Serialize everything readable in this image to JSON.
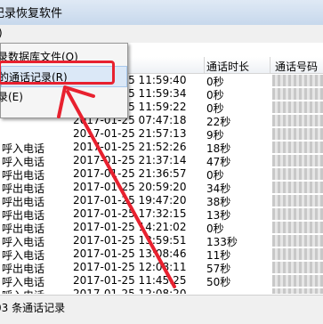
{
  "window": {
    "title": "记录恢复软件"
  },
  "menubar": {
    "first_menu": ")"
  },
  "dropdown": {
    "items": [
      {
        "label": "录数据库文件(O)"
      },
      {
        "label": "的通话记录(R)"
      },
      {
        "label": "录(E)"
      }
    ]
  },
  "table": {
    "headers": [
      "通话时长",
      "通话号码"
    ],
    "rows": [
      {
        "type": "",
        "time": "2017-01-25 11:59:40",
        "duration": "0秒"
      },
      {
        "type": "",
        "time": "2017-01-25 11:59:34",
        "duration": "0秒"
      },
      {
        "type": "",
        "time": "2017-01-25 11:59:22",
        "duration": "0秒"
      },
      {
        "type": "",
        "time": "2017-01-25 07:47:18",
        "duration": "22秒"
      },
      {
        "type": "",
        "time": "2017-01-25 21:57:13",
        "duration": "9秒"
      },
      {
        "type": "呼入电话",
        "time": "2017-01-25 21:52:26",
        "duration": "18秒"
      },
      {
        "type": "呼入电话",
        "time": "2017-01-25 21:37:14",
        "duration": "47秒"
      },
      {
        "type": "呼出电话",
        "time": "2017-01-25 21:36:57",
        "duration": "0秒"
      },
      {
        "type": "呼出电话",
        "time": "2017-01-25 20:59:20",
        "duration": "34秒"
      },
      {
        "type": "呼出电话",
        "time": "2017-01-25 19:47:20",
        "duration": "38秒"
      },
      {
        "type": "呼出电话",
        "time": "2017-01-25 17:32:15",
        "duration": "13秒"
      },
      {
        "type": "呼出电话",
        "time": "2017-01-25 14:21:02",
        "duration": "0秒"
      },
      {
        "type": "呼入电话",
        "time": "2017-01-25 13:59:51",
        "duration": "133秒"
      },
      {
        "type": "呼入电话",
        "time": "2017-01-25 13:08:46",
        "duration": "11秒"
      },
      {
        "type": "呼出电话",
        "time": "2017-01-25 12:08:11",
        "duration": "57秒"
      },
      {
        "type": "呼入电话",
        "time": "2017-01-25 11:45:25",
        "duration": "50秒"
      },
      {
        "type": "呼入电话",
        "time": "2017-01-25 12:08:20",
        "duration": ""
      }
    ]
  },
  "status": {
    "text": "03 条通话记录"
  },
  "colors": {
    "highlight_box": "#e8212f",
    "arrow": "#e8212f",
    "menu_hover": "#dbe8f7"
  }
}
